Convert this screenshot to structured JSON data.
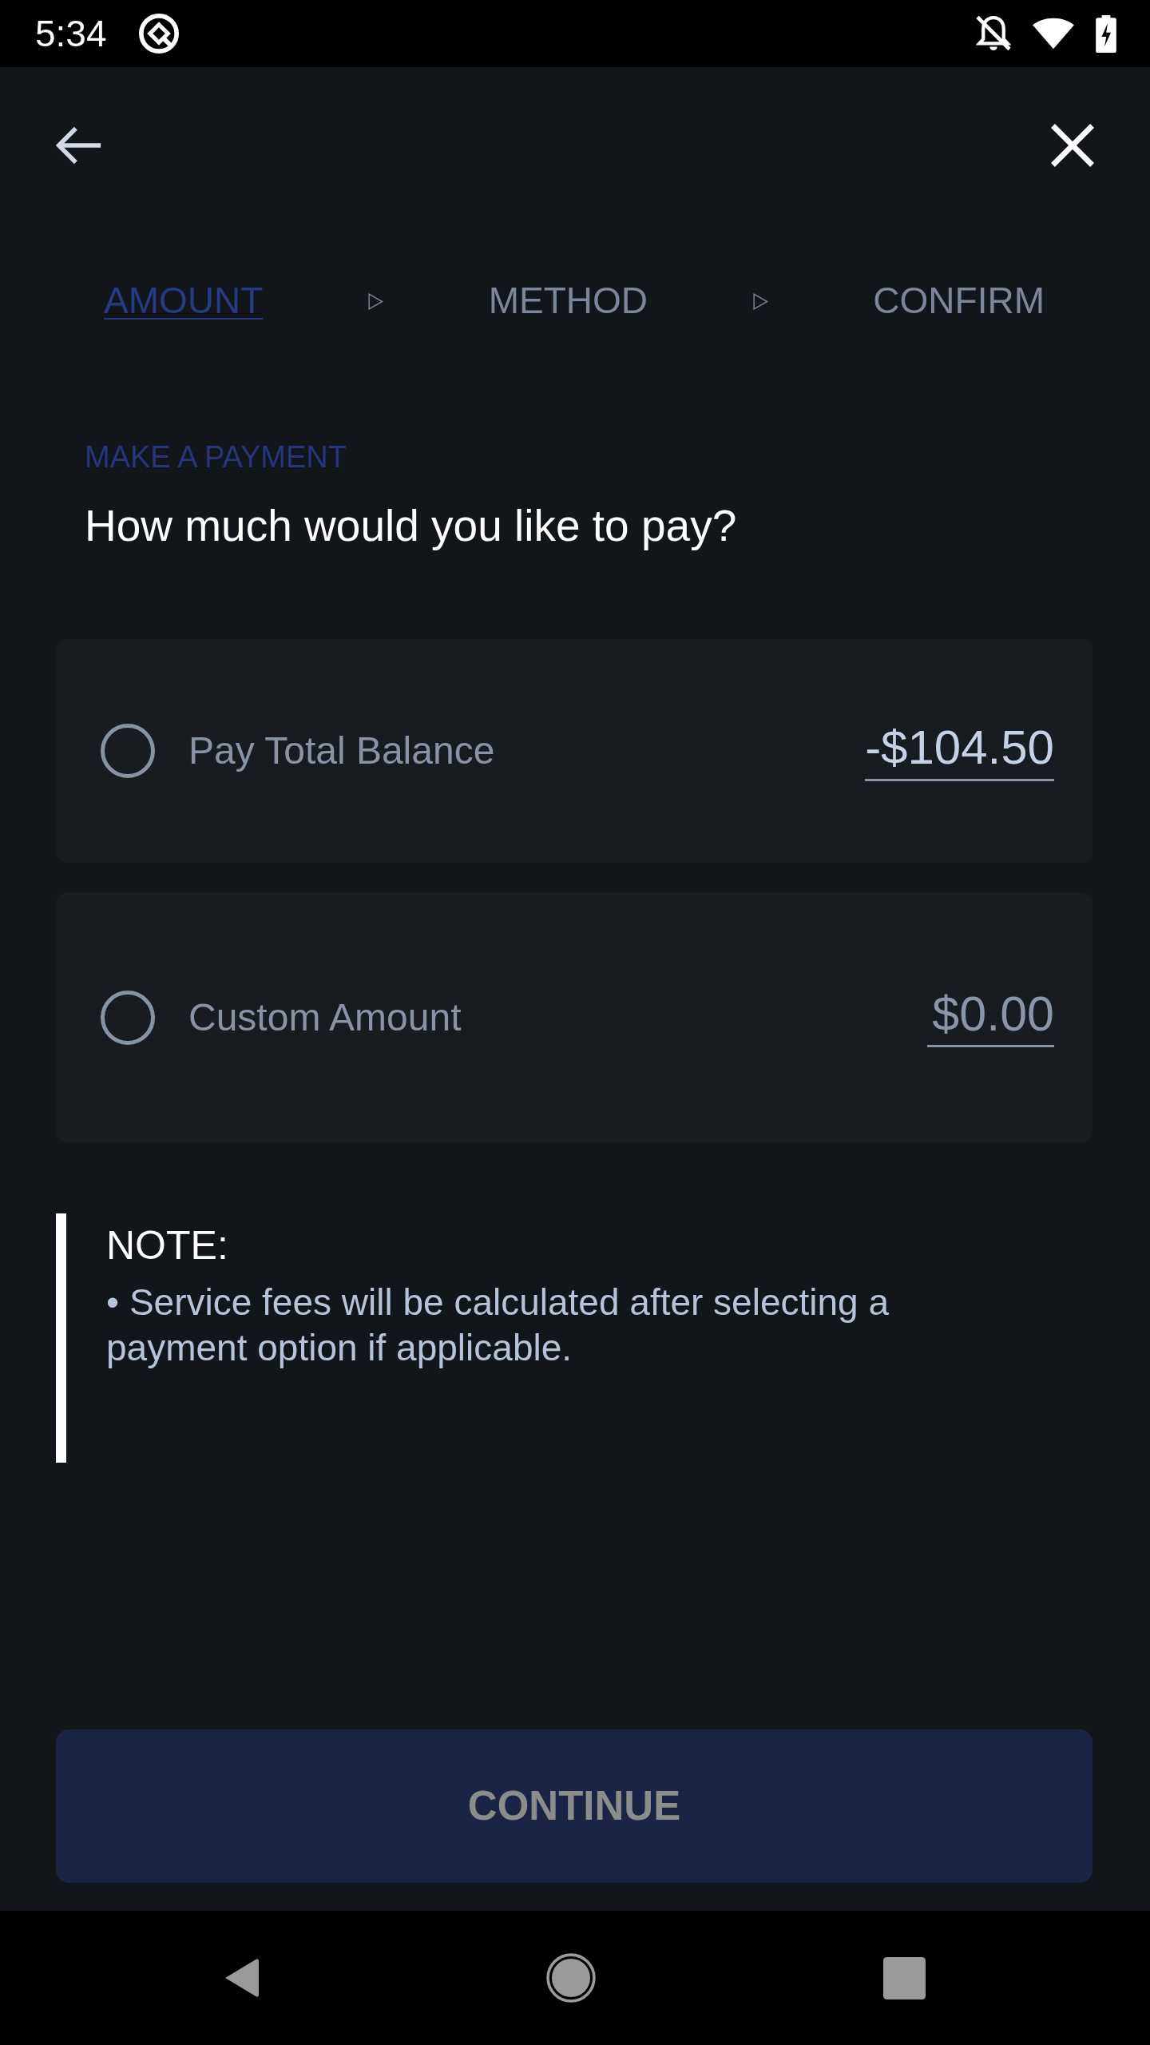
{
  "status_bar": {
    "time": "5:34"
  },
  "steps": [
    {
      "label": "AMOUNT",
      "selected": true
    },
    {
      "label": "METHOD",
      "selected": false
    },
    {
      "label": "CONFIRM",
      "selected": false
    }
  ],
  "header": {
    "eyebrow": "MAKE A PAYMENT",
    "question": "How much would you like to pay?"
  },
  "options": [
    {
      "kind": "fixed",
      "label": "Pay Total Balance",
      "amount": "-$104.50",
      "selected": false
    },
    {
      "kind": "input",
      "label": "Custom Amount",
      "placeholder": "$0.00",
      "selected": false
    }
  ],
  "note": {
    "title": "NOTE:",
    "text": "• Service fees will be calculated after selecting a payment option if applicable."
  },
  "continue_button": {
    "label": "CONTINUE",
    "disabled": true
  }
}
